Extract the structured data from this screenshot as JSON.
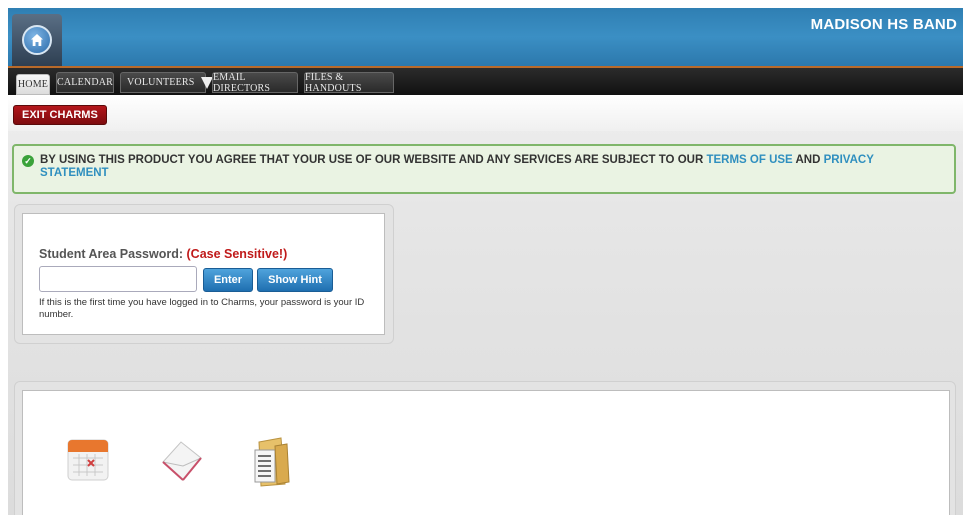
{
  "header": {
    "brand": "MADISON HS BAND",
    "brand_top": "................................"
  },
  "nav": {
    "tabs": [
      {
        "label": "HOME"
      },
      {
        "label": "CALENDAR"
      },
      {
        "label": "VOLUNTEERS"
      },
      {
        "label": "EMAIL DIRECTORS"
      },
      {
        "label": "FILES & HANDOUTS"
      }
    ]
  },
  "subbar": {
    "exit_label": "EXIT CHARMS"
  },
  "notice": {
    "text_before": "BY USING THIS PRODUCT YOU AGREE THAT YOUR USE OF OUR WEBSITE AND ANY SERVICES ARE SUBJECT TO OUR ",
    "terms_link": "TERMS OF USE",
    "and": " AND ",
    "privacy_link": "PRIVACY STATEMENT"
  },
  "login": {
    "label": "Student Area Password: ",
    "warning": "(Case Sensitive!)",
    "password_value": "",
    "enter_label": "Enter",
    "hint_label": "Show Hint",
    "note": "If this is the first time you have logged in to Charms, your password is your ID number."
  },
  "icons": [
    "calendar-icon",
    "envelope-icon",
    "folder-documents-icon"
  ],
  "colors": {
    "header_blue": "#2f7fb3",
    "nav_dark": "#1a1a1a",
    "exit_red": "#9b1115",
    "notice_green": "#7fb66a",
    "link_blue": "#2f8fbf",
    "warning_red": "#c01a1a",
    "button_blue": "#2f86c6"
  }
}
